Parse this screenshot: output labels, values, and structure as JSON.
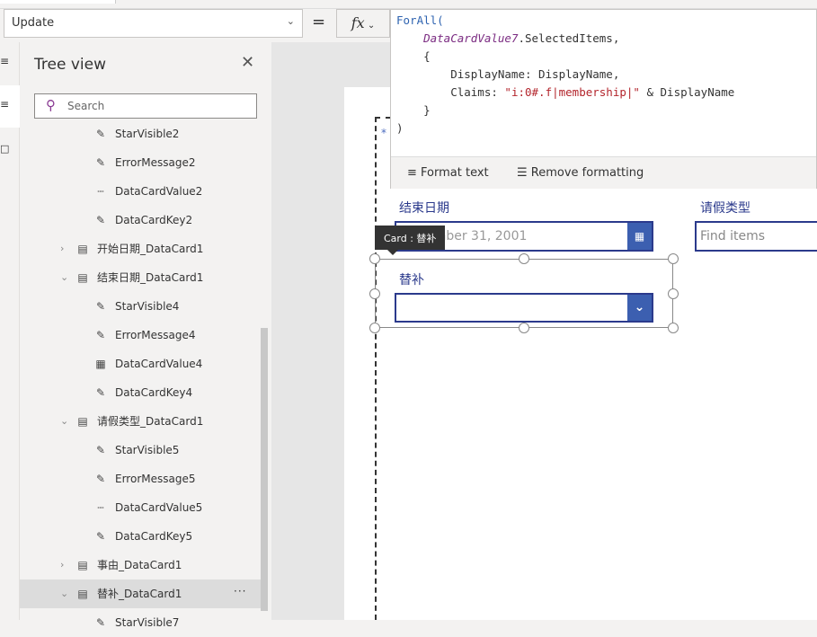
{
  "toolbar": {
    "property": "Update",
    "equals": "=",
    "fx": "fx"
  },
  "tree": {
    "title": "Tree view",
    "search_placeholder": "Search",
    "items": [
      {
        "label": "StarVisible2",
        "icon": "edit-icon",
        "level": 2
      },
      {
        "label": "ErrorMessage2",
        "icon": "edit-icon",
        "level": 2
      },
      {
        "label": "DataCardValue2",
        "icon": "textinput-icon",
        "level": 2
      },
      {
        "label": "DataCardKey2",
        "icon": "edit-icon",
        "level": 2
      },
      {
        "label": "开始日期_DataCard1",
        "icon": "card-icon",
        "level": 1,
        "expanded": false
      },
      {
        "label": "结束日期_DataCard1",
        "icon": "card-icon",
        "level": 1,
        "expanded": true
      },
      {
        "label": "StarVisible4",
        "icon": "edit-icon",
        "level": 2
      },
      {
        "label": "ErrorMessage4",
        "icon": "edit-icon",
        "level": 2
      },
      {
        "label": "DataCardValue4",
        "icon": "calendar-icon",
        "level": 2
      },
      {
        "label": "DataCardKey4",
        "icon": "edit-icon",
        "level": 2
      },
      {
        "label": "请假类型_DataCard1",
        "icon": "card-icon",
        "level": 1,
        "expanded": true
      },
      {
        "label": "StarVisible5",
        "icon": "edit-icon",
        "level": 2
      },
      {
        "label": "ErrorMessage5",
        "icon": "edit-icon",
        "level": 2
      },
      {
        "label": "DataCardValue5",
        "icon": "textinput-icon",
        "level": 2
      },
      {
        "label": "DataCardKey5",
        "icon": "edit-icon",
        "level": 2
      },
      {
        "label": "事由_DataCard1",
        "icon": "card-icon",
        "level": 1,
        "expanded": false
      },
      {
        "label": "替补_DataCard1",
        "icon": "card-icon",
        "level": 1,
        "expanded": true,
        "selected": true,
        "more": "···"
      },
      {
        "label": "StarVisible7",
        "icon": "edit-icon",
        "level": 2
      }
    ]
  },
  "formula": {
    "lines": [
      [
        {
          "t": "ForAll(",
          "c": "kw"
        }
      ],
      [
        {
          "t": "    "
        },
        {
          "t": "DataCardValue7",
          "c": "ctl"
        },
        {
          "t": ".SelectedItems,"
        }
      ],
      [
        {
          "t": "    {"
        }
      ],
      [
        {
          "t": "        DisplayName: DisplayName,"
        }
      ],
      [
        {
          "t": "        Claims: "
        },
        {
          "t": "\"i:0#.f|membership|\"",
          "c": "str"
        },
        {
          "t": " & DisplayName"
        }
      ],
      [
        {
          "t": "    }"
        }
      ],
      [
        {
          "t": ")"
        }
      ]
    ],
    "format_text": "Format text",
    "remove_formatting": "Remove formatting"
  },
  "form": {
    "star": "*",
    "end_date_label": "结束日期",
    "end_date_value": "December 31, 2001",
    "leave_type_label": "请假类型",
    "leave_type_placeholder": "Find items",
    "substitute_label": "替补",
    "tooltip": "Card : 替补"
  },
  "colors": {
    "accent": "#3c5fb0",
    "label": "#2b3a8c",
    "selected_row": "#dcdcdc"
  }
}
